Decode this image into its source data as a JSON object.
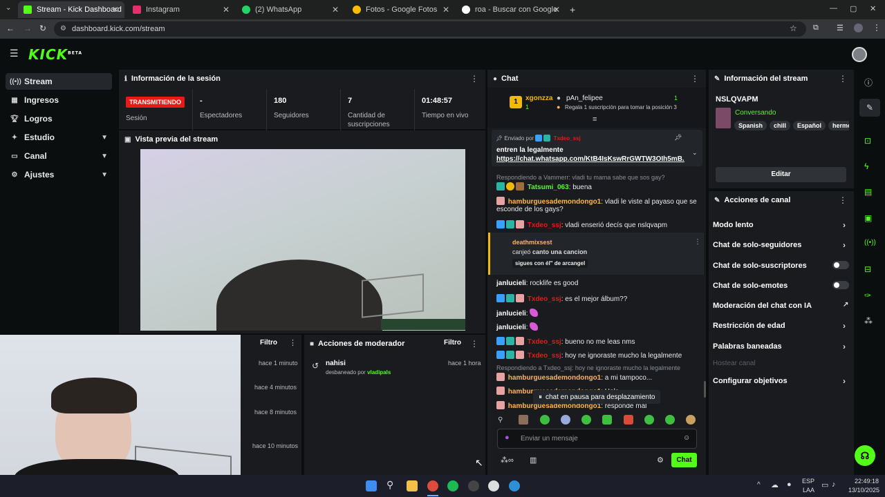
{
  "browser": {
    "tabs": [
      {
        "title": "Stream - Kick Dashboard",
        "color": "#53fc18",
        "active": true
      },
      {
        "title": "Instagram",
        "color": "#e1306c",
        "active": false
      },
      {
        "title": "(2) WhatsApp",
        "color": "#25d366",
        "active": false
      },
      {
        "title": "Fotos - Google Fotos",
        "color": "#fbbc04",
        "active": false
      },
      {
        "title": "roa - Buscar con Google",
        "color": "#ffffff",
        "active": false
      }
    ],
    "url": "dashboard.kick.com/stream"
  },
  "sidebar": {
    "items": [
      {
        "label": "Stream",
        "icon": "broadcast-icon"
      },
      {
        "label": "Ingresos",
        "icon": "money-icon"
      },
      {
        "label": "Logros",
        "icon": "trophy-icon"
      },
      {
        "label": "Estudio",
        "icon": "studio-icon"
      },
      {
        "label": "Canal",
        "icon": "channel-icon"
      },
      {
        "label": "Ajustes",
        "icon": "gear-icon"
      }
    ]
  },
  "session": {
    "title": "Información de la sesión",
    "status_badge": "TRANSMITIENDO",
    "session_label": "Sesión",
    "stats": [
      {
        "value": "-",
        "label": "Espectadores"
      },
      {
        "value": "180",
        "label": "Seguidores"
      },
      {
        "value": "7",
        "label": "Cantidad de suscripciones"
      },
      {
        "value": "01:48:57",
        "label": "Tiempo en vivo"
      }
    ]
  },
  "preview": {
    "title": "Vista previa del stream"
  },
  "activity": {
    "filter_label": "Filtro",
    "times": [
      "hace 1 minuto",
      "hace 4 minutos",
      "hace 8 minutos",
      "hace 10 minutos"
    ]
  },
  "modactions": {
    "title": "Acciones de moderador",
    "filter_label": "Filtro",
    "entry": {
      "user": "nahisi",
      "text": "desbaneado por",
      "by": "vladipals",
      "time": "hace 1 hora"
    }
  },
  "chat": {
    "title": "Chat",
    "top_gifters": [
      {
        "name": "xgonzza",
        "count": "1"
      },
      {
        "name": "pAn_felipee",
        "count": "1"
      }
    ],
    "gift_prompt": "Regala 1 suscripción para tomar la posición 3",
    "pinned": {
      "sent_by": "Enviado por",
      "user": "Txdeo_ssj",
      "text": "entren la legalmente",
      "link": "https://chat.whatsapp.com/KtB4IsKswRrGWTW3OIh5mB..."
    },
    "messages": [
      {
        "type": "reply",
        "text": "Respondiendo a Vammerr: vladi tu mama sabe que sos gay?"
      },
      {
        "user": "Tatsumi_063",
        "color": "#53fc18",
        "text": "buena"
      },
      {
        "user": "hamburguesademondongo1",
        "color": "#ffb74d",
        "text": "vladi le viste al payaso que se"
      },
      {
        "type": "cont",
        "text": "esconde de los gays?"
      },
      {
        "user": "Txdeo_ssj",
        "color": "#e91916",
        "text": "vladi enserió decís que nslqvapm"
      },
      {
        "type": "highlight",
        "user": "deathmixsest",
        "color": "#ffb74d",
        "pre": "canjeó",
        "reward": "canto una cancion",
        "extra": "sigues con él\" de arcangel"
      },
      {
        "user": "janlucieli",
        "color": "#ffffff",
        "text": "rocklife es good"
      },
      {
        "user": "Txdeo_ssj",
        "color": "#e91916",
        "text": "es el mejor álbum??"
      },
      {
        "user": "janlucieli",
        "color": "#ffffff",
        "text": ""
      },
      {
        "user": "janlucieli",
        "color": "#ffffff",
        "text": ""
      },
      {
        "user": "Txdeo_ssj",
        "color": "#e91916",
        "text": "bueno no me leas nms"
      },
      {
        "user": "Txdeo_ssj",
        "color": "#e91916",
        "text": "hoy ne ignoraste mucho la legalmente"
      },
      {
        "type": "reply",
        "text": "Respondiendo a Txdeo_ssj: hoy ne ignoraste mucho la legalmente"
      },
      {
        "user": "hamburguesademondongo1",
        "color": "#ffb74d",
        "text": "a mi tampoco..."
      },
      {
        "user": "hamburguesademondongo1",
        "color": "#ffb74d",
        "text": "Hola"
      },
      {
        "user": "hamburguesademondongo1",
        "color": "#ffb74d",
        "text": "responde mal"
      }
    ],
    "paused_text": "chat en pausa para desplazamiento",
    "input_placeholder": "Enviar un mensaje",
    "send_label": "Chat"
  },
  "streaminfo": {
    "title": "Información del stream",
    "stream_title": "NSLQVAPM",
    "category": "Conversando",
    "tags": [
      "Spanish",
      "chill",
      "Español",
      "hermoso"
    ],
    "edit_label": "Editar"
  },
  "channel_actions": {
    "title": "Acciones de canal",
    "items": [
      {
        "label": "Modo lento",
        "control": "arrow"
      },
      {
        "label": "Chat de solo-seguidores",
        "control": "arrow"
      },
      {
        "label": "Chat de solo-suscriptores",
        "control": "toggle"
      },
      {
        "label": "Chat de solo-emotes",
        "control": "toggle"
      },
      {
        "label": "Moderación del chat con IA",
        "control": "external"
      },
      {
        "label": "Restricción de edad",
        "control": "arrow"
      },
      {
        "label": "Palabras baneadas",
        "control": "arrow"
      },
      {
        "label": "Hostear canal",
        "control": "disabled"
      },
      {
        "label": "Configurar objetivos",
        "control": "arrow"
      }
    ]
  },
  "taskbar": {
    "lang": "ESP",
    "lang2": "LAA",
    "time": "22:49:18",
    "date": "13/10/2025"
  },
  "colors": {
    "brand": "#53fc18",
    "live": "#e91916",
    "panel": "#191b1f"
  }
}
